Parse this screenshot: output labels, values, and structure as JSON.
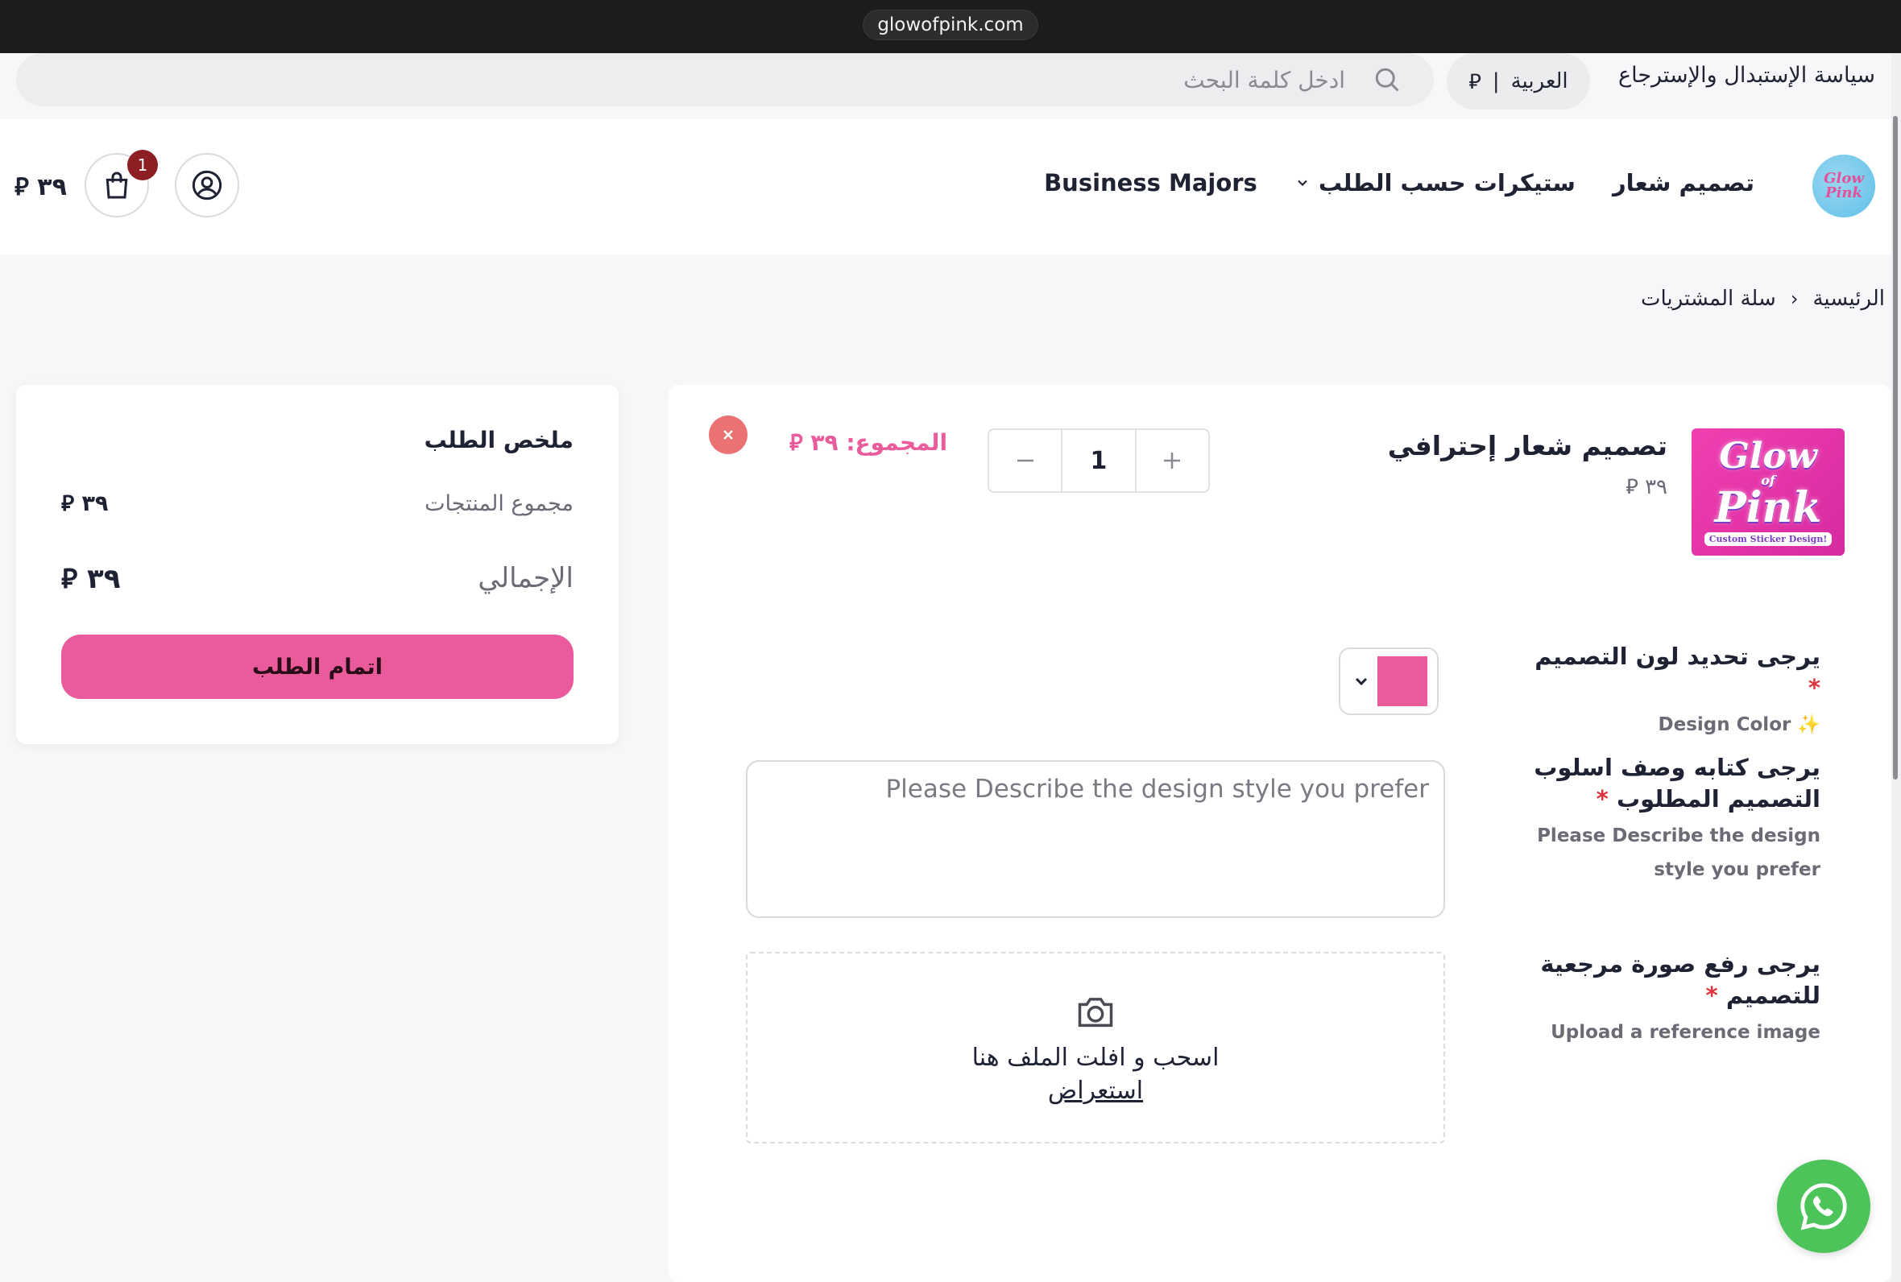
{
  "browser": {
    "url": "glowofpink.com"
  },
  "topbar": {
    "policy_link": "سياسة الإستبدال والإسترجاع",
    "language": "العربية",
    "language_sep": "|",
    "currency_symbol": "⃁",
    "search_placeholder": "ادخل كلمة البحث"
  },
  "header": {
    "logo_text": "Glow Pink",
    "nav": [
      {
        "label": "تصميم شعار"
      },
      {
        "label": "ستيكرات حسب الطلب",
        "has_dropdown": true
      },
      {
        "label": "Business Majors"
      }
    ],
    "cart_count": "1",
    "cart_total": "٣٩ ⃁"
  },
  "breadcrumb": {
    "home": "الرئيسية",
    "separator": "‹",
    "current": "سلة المشتريات"
  },
  "summary": {
    "title": "ملخص الطلب",
    "subtotal_label": "مجموع المنتجات",
    "subtotal_value": "٣٩ ⃁",
    "total_label": "الإجمالي",
    "total_value": "٣٩ ⃁",
    "checkout_label": "اتمام الطلب"
  },
  "cart_item": {
    "image_text": {
      "line1": "Glow",
      "line2": "of",
      "line3": "Pink",
      "tagline": "Custom Sticker Design!"
    },
    "name": "تصميم شعار إحترافي",
    "unit_price": "٣٩ ⃁",
    "quantity": "1",
    "line_total": "المجموع: ٣٩ ⃁"
  },
  "form": {
    "color": {
      "label_ar": "يرجى تحديد لون التصميم",
      "required_mark": "*",
      "label_en": "✨ Design Color",
      "selected_color": "#ea5b9b"
    },
    "description": {
      "label_ar": "يرجى كتابه وصف اسلوب التصميم المطلوب",
      "required_mark": "*",
      "label_en": "Please Describe the design style you prefer",
      "placeholder": "Please Describe the design style you prefer"
    },
    "upload": {
      "label_ar": "يرجى رفع صورة مرجعية للتصميم",
      "required_mark": "*",
      "label_en": "Upload a reference image",
      "drop_text": "اسحب و افلت الملف هنا",
      "browse_label": "استعراض"
    }
  },
  "colors": {
    "accent": "#ea5b9b",
    "badge": "#8d1f24",
    "remove": "#ea7272",
    "whatsapp": "#4cc45a"
  }
}
